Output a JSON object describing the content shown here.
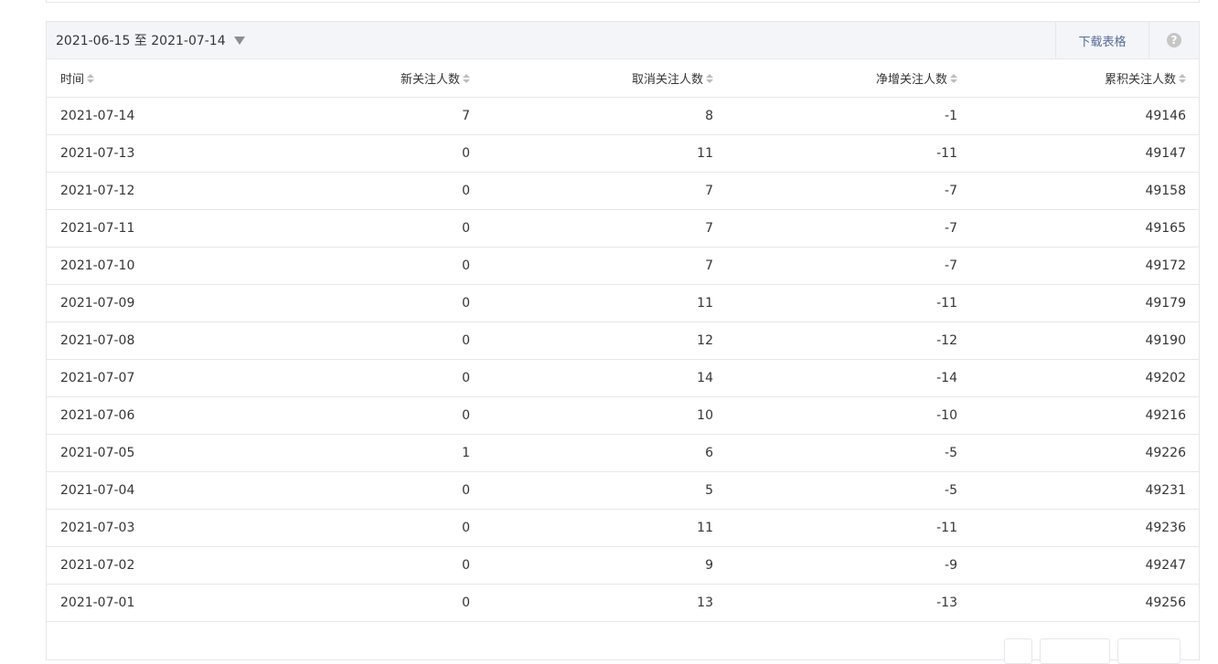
{
  "toolbar": {
    "date_range": "2021-06-15 至 2021-07-14",
    "download_label": "下载表格",
    "help_label": "?"
  },
  "table": {
    "headers": [
      "时间",
      "新关注人数",
      "取消关注人数",
      "净增关注人数",
      "累积关注人数"
    ],
    "rows": [
      [
        "2021-07-14",
        "7",
        "8",
        "-1",
        "49146"
      ],
      [
        "2021-07-13",
        "0",
        "11",
        "-11",
        "49147"
      ],
      [
        "2021-07-12",
        "0",
        "7",
        "-7",
        "49158"
      ],
      [
        "2021-07-11",
        "0",
        "7",
        "-7",
        "49165"
      ],
      [
        "2021-07-10",
        "0",
        "7",
        "-7",
        "49172"
      ],
      [
        "2021-07-09",
        "0",
        "11",
        "-11",
        "49179"
      ],
      [
        "2021-07-08",
        "0",
        "12",
        "-12",
        "49190"
      ],
      [
        "2021-07-07",
        "0",
        "14",
        "-14",
        "49202"
      ],
      [
        "2021-07-06",
        "0",
        "10",
        "-10",
        "49216"
      ],
      [
        "2021-07-05",
        "1",
        "6",
        "-5",
        "49226"
      ],
      [
        "2021-07-04",
        "0",
        "5",
        "-5",
        "49231"
      ],
      [
        "2021-07-03",
        "0",
        "11",
        "-11",
        "49236"
      ],
      [
        "2021-07-02",
        "0",
        "9",
        "-9",
        "49247"
      ],
      [
        "2021-07-01",
        "0",
        "13",
        "-13",
        "49256"
      ]
    ]
  },
  "colors": {
    "link": "#576b95",
    "border": "#e7e7eb",
    "toolbar_bg": "#f4f5f9",
    "text": "#353535"
  }
}
